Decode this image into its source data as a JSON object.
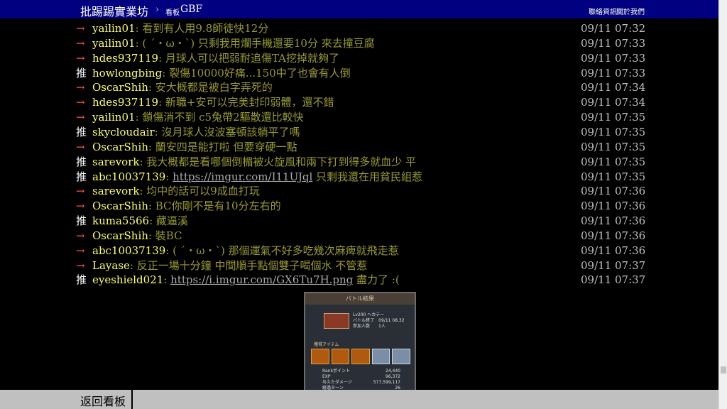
{
  "header": {
    "site_name": "批踢踢實業坊",
    "crumb_arrow": "›",
    "board_label": "看板",
    "board_name": "GBF",
    "links": [
      "聯絡資訊",
      "關於我們"
    ]
  },
  "pushes": [
    {
      "tag": "→",
      "user": "yailin01",
      "content": ": 看到有人用9.8師徒快12分",
      "time": "09/11 07:32"
    },
    {
      "tag": "→",
      "user": "yailin01",
      "content": ": ( ´・ω・`) 只剩我用爛手機還要10分 來去撞豆腐",
      "time": "09/11 07:33"
    },
    {
      "tag": "→",
      "user": "hdes937119",
      "content": ": 月球人可以把弱耐追傷TA挖掉就夠了",
      "time": "09/11 07:33"
    },
    {
      "tag": "推",
      "user": "howlongbing",
      "content": ": 裂傷10000好痛...150中了也會有人倒",
      "time": "09/11 07:33"
    },
    {
      "tag": "→",
      "user": "OscarShih",
      "content": ": 安大概都是被白字弄死的",
      "time": "09/11 07:34"
    },
    {
      "tag": "→",
      "user": "hdes937119",
      "content": ": 新職+安可以完美封印弱體，還不錯",
      "time": "09/11 07:34"
    },
    {
      "tag": "→",
      "user": "yailin01",
      "content": ": 鎖傷消不到 c5兔帶2驅散還比較快",
      "time": "09/11 07:35"
    },
    {
      "tag": "推",
      "user": "skycloudair",
      "content": ": 沒月球人沒波塞頓該躺平了嗎",
      "time": "09/11 07:35"
    },
    {
      "tag": "→",
      "user": "OscarShih",
      "content": ": 蘭安四是能打啦 但要穿硬一點",
      "time": "09/11 07:35"
    },
    {
      "tag": "推",
      "user": "sarevork",
      "content": ": 我大概都是看哪個倒楣被火旋風和兩下打到得多就血少 平",
      "time": "09/11 07:35"
    },
    {
      "tag": "推",
      "user": "abc10037139",
      "content": ": ",
      "link": "https://imgur.com/I11UJql",
      "content_after": " 只剩我還在用貧民組惹",
      "time": "09/11 07:35"
    },
    {
      "tag": "→",
      "user": "sarevork",
      "content": ": 均中的話可以9成血打玩",
      "time": "09/11 07:36"
    },
    {
      "tag": "→",
      "user": "OscarShih",
      "content": ": BC你剛不是有10分左右的",
      "time": "09/11 07:36"
    },
    {
      "tag": "推",
      "user": "kuma5566",
      "content": ": 藏逼溪",
      "time": "09/11 07:36"
    },
    {
      "tag": "→",
      "user": "OscarShih",
      "content": ": 裝BC",
      "time": "09/11 07:36"
    },
    {
      "tag": "→",
      "user": "abc10037139",
      "content": ": ( ´・ω・`) 那個運氣不好多吃幾次麻痺就飛走惹",
      "time": "09/11 07:36"
    },
    {
      "tag": "→",
      "user": "Layase",
      "content": ": 反正一場十分鐘 中間順手點個雙子喝個水 不管惹",
      "time": "09/11 07:37"
    },
    {
      "tag": "推",
      "user": "eyeshield021",
      "content": ": ",
      "link": "https://i.imgur.com/GX6Tu7H.png",
      "content_after": " 盡力了 :(",
      "time": "09/11 07:37"
    }
  ],
  "preview": {
    "header": "バトル結果",
    "info_lines": [
      "Lv200 ヘカテー",
      "バトル終了　09/11 08.32",
      "参加人数　　1人"
    ],
    "section": "獲得アイテム",
    "stats": [
      {
        "label": "Rankポイント",
        "value": "24,440"
      },
      {
        "label": "EXP",
        "value": "96,372"
      },
      {
        "label": "与えたダメージ",
        "value": "577,599,117"
      },
      {
        "label": "経過ターン",
        "value": "26"
      }
    ]
  },
  "footer": {
    "back_label": "返回看板"
  }
}
